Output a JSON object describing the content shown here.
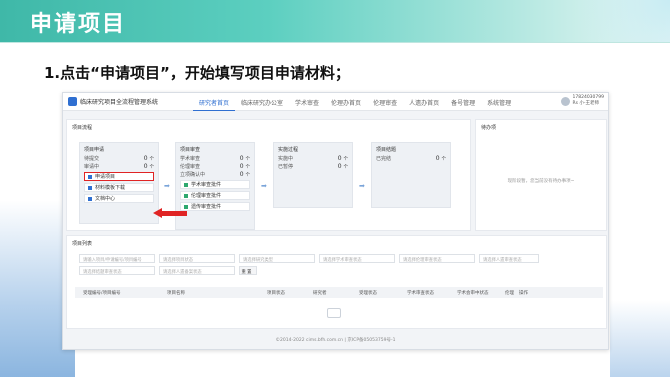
{
  "slide": {
    "title": "申请项目",
    "instruction": "1.点击“申请项目”，开始填写项目申请材料；"
  },
  "app": {
    "title": "临床研究项目全流程管理系统",
    "nav": [
      "研究者首页",
      "临床研究办公室",
      "学术审查",
      "伦理办首页",
      "伦理审查",
      "人遗办首页",
      "备号管理",
      "系统管理"
    ],
    "user": {
      "phone": "17824030799",
      "role": "Rs&nbsp;小-王老师"
    },
    "flow": {
      "title": "项目流程",
      "apply": {
        "head": "项目申请",
        "rows": [
          {
            "label": "待提交",
            "count": "0",
            "unit": "个"
          },
          {
            "label": "审请中",
            "count": "0",
            "unit": "个"
          }
        ],
        "btns": [
          "申请项目",
          "材料模板下载",
          "文档中心"
        ]
      },
      "review": {
        "head": "项目审查",
        "rows": [
          {
            "label": "学术审查",
            "count": "0",
            "unit": "个"
          },
          {
            "label": "伦理审查",
            "count": "0",
            "unit": "个"
          },
          {
            "label": "立项确认中",
            "count": "0",
            "unit": "个"
          }
        ],
        "btns": [
          "学术审查批件",
          "伦理审查批件",
          "遗传审查批件"
        ]
      },
      "process": {
        "head": "实施过程",
        "rows": [
          {
            "label": "实施中",
            "count": "0",
            "unit": "个"
          },
          {
            "label": "已暂停",
            "count": "0",
            "unit": "个"
          }
        ]
      },
      "done": {
        "head": "项目结题",
        "rows": [
          {
            "label": "已完结",
            "count": "0",
            "unit": "个"
          }
        ]
      }
    },
    "todo": {
      "title": "待办项",
      "empty": "现阶段暂，您当前没有待办事项~"
    },
    "list": {
      "title": "项目列表",
      "filters": [
        [
          "请输入项目/申请编号/项目编号",
          "请选择项目状态",
          "请选择研究类型",
          "请选择学术审查状态",
          "请选择伦理审查状态",
          "请选择人遗审查状态",
          "请选择学术会审中状态"
        ],
        [
          "请选择结题审查状态",
          "请选择人遗备案状态",
          "重 置"
        ]
      ],
      "columns": [
        "受理编号/项目编号",
        "项目名称",
        "项目状态",
        "研究者",
        "受理状态",
        "学术审查状态",
        "学术会审中状态",
        "伦理",
        "操作"
      ]
    },
    "footer": "©2014-2022 cims.bfh.com.cn | 京ICP备05053759号-1"
  },
  "colors": {
    "accent": "#2f6fd1",
    "header": "#3fb8a8",
    "highlight": "#e02424"
  }
}
